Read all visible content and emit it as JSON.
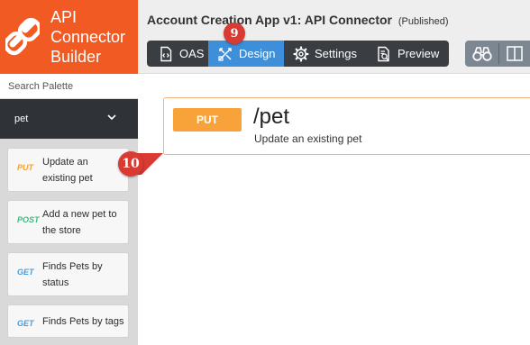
{
  "brand": {
    "title_lines": [
      "API",
      "Connector",
      "Builder"
    ],
    "color": "#f15a22"
  },
  "palette": {
    "search_placeholder": "Search Palette",
    "filter_value": "pet",
    "items": [
      {
        "method": "PUT",
        "description": "Update an existing pet",
        "lines": [
          "Update an",
          "existing pet"
        ]
      },
      {
        "method": "POST",
        "description": "Add a new pet to the store",
        "lines": [
          "Add a new pet to",
          "the store"
        ]
      },
      {
        "method": "GET",
        "description": "Finds Pets by status",
        "lines": [
          "Finds Pets by",
          "status"
        ]
      },
      {
        "method": "GET",
        "description": "Finds Pets by tags",
        "lines": [
          "Finds Pets by tags"
        ]
      }
    ]
  },
  "header": {
    "app_title": "Account Creation App v1: API Connector",
    "status": "(Published)"
  },
  "tabs": [
    {
      "label": "OAS",
      "icon": "code-file-icon",
      "active": false
    },
    {
      "label": "Design",
      "icon": "design-tools-icon",
      "active": true
    },
    {
      "label": "Settings",
      "icon": "gear-icon",
      "active": false
    },
    {
      "label": "Preview",
      "icon": "preview-document-icon",
      "active": false
    }
  ],
  "toolbar": {
    "icons": [
      "binoculars-icon",
      "split-view-icon"
    ]
  },
  "operation": {
    "method": "PUT",
    "path": "/pet",
    "summary": "Update an existing pet"
  },
  "step_badges": {
    "design": "9",
    "palette": "10"
  },
  "colors": {
    "accent_orange": "#f15a22",
    "active_tab": "#3d8fd9",
    "tab_bar": "#3a3d42",
    "put": "#f7a33a",
    "post": "#41b883",
    "get": "#4a9bd6",
    "badge": "#d93a32"
  }
}
